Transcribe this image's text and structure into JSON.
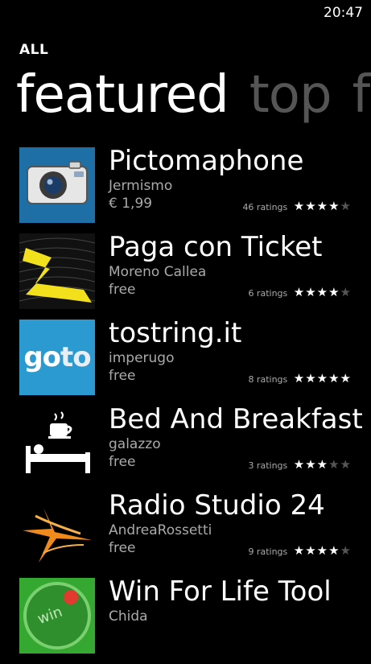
{
  "status": {
    "time": "20:47"
  },
  "header": {
    "breadcrumb": "ALL"
  },
  "pivot": {
    "tabs": [
      "featured",
      "top",
      "fr"
    ],
    "active": 0
  },
  "apps": [
    {
      "name": "Pictomaphone",
      "publisher": "Jermismo",
      "price": "€ 1,99",
      "ratings_label": "46 ratings",
      "stars": 4.5,
      "icon": "camera-icon",
      "tile_color": "#1d6fa5"
    },
    {
      "name": "Paga con Ticket",
      "publisher": "Moreno Callea",
      "price": "free",
      "ratings_label": "6 ratings",
      "stars": 4.5,
      "icon": "ticket-wave-icon",
      "tile_color": "#111111"
    },
    {
      "name": "tostring.it",
      "publisher": "imperugo",
      "price": "free",
      "ratings_label": "8 ratings",
      "stars": 5,
      "icon": "goto-logo-icon",
      "tile_color": "#2a9ad0"
    },
    {
      "name": "Bed And Breakfast",
      "publisher": "galazzo",
      "price": "free",
      "ratings_label": "3 ratings",
      "stars": 3.5,
      "icon": "bed-coffee-icon",
      "tile_color": "#000000"
    },
    {
      "name": "Radio Studio 24",
      "publisher": "AndreaRossetti",
      "price": "free",
      "ratings_label": "9 ratings",
      "stars": 4,
      "icon": "radio-logo-icon",
      "tile_color": "#000000"
    },
    {
      "name": "Win For Life Tool",
      "publisher": "Chida",
      "price": "",
      "ratings_label": "",
      "stars": 0,
      "icon": "win-for-life-icon",
      "tile_color": "#35a832"
    }
  ]
}
